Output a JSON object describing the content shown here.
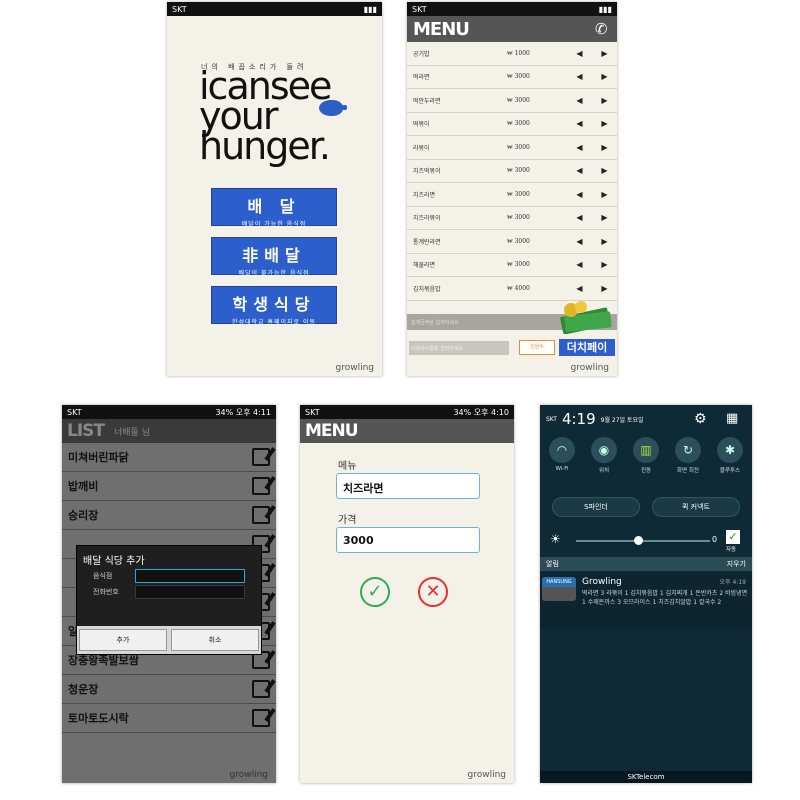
{
  "colors": {
    "accent_blue": "#2c5fcc",
    "check_green": "#33aa55",
    "cancel_red": "#e53030",
    "input_border": "#6ab4d9"
  },
  "screen1": {
    "carrier": "SKT",
    "tagline": "너의 배꼽소리가 들려",
    "logo_lines": [
      "icansee",
      "your",
      "hunger."
    ],
    "buttons": [
      {
        "main": "배 달",
        "sub": "배달이 가능한 음식점"
      },
      {
        "main": "非배달",
        "sub": "배달이 불가능한 음식점"
      },
      {
        "main": "학생식당",
        "sub": "한성대학교 홈페이지로 이동"
      }
    ],
    "brand": "growling"
  },
  "screen2": {
    "carrier": "SKT",
    "title": "MENU",
    "items": [
      {
        "name": "공기밥",
        "price": "₩ 1000"
      },
      {
        "name": "떡라면",
        "price": "₩ 3000"
      },
      {
        "name": "떡만두라면",
        "price": "₩ 3000"
      },
      {
        "name": "떡볶이",
        "price": "₩ 3000"
      },
      {
        "name": "라볶이",
        "price": "₩ 3000"
      },
      {
        "name": "치즈떡볶이",
        "price": "₩ 3000"
      },
      {
        "name": "치즈라면",
        "price": "₩ 3000"
      },
      {
        "name": "치즈라볶이",
        "price": "₩ 3000"
      },
      {
        "name": "통계란라면",
        "price": "₩ 3000"
      },
      {
        "name": "해물라면",
        "price": "₩ 3000"
      },
      {
        "name": "김치볶음밥",
        "price": "₩ 4000"
      }
    ],
    "footer_placeholder": "합계금액을 입력하세요",
    "input_placeholder": "사용자이름을 입력하세요",
    "count_label": "인원수",
    "pay_button": "더치페이",
    "brand": "growling"
  },
  "screen3": {
    "carrier": "SKT",
    "status_right": "34% 오후 4:11",
    "title": "LIST",
    "subtitle": "너배들 님",
    "items": [
      "미쳐버린파닭",
      "밥깨비",
      "승리장",
      "",
      "",
      "",
      "일품돈까스",
      "장충왕족발보쌈",
      "청운장",
      "토마토도시락"
    ],
    "dialog": {
      "title": "배달 식당 추가",
      "field1": "음식점",
      "field2": "전화번호",
      "add": "추가",
      "cancel": "취소"
    },
    "brand": "growling"
  },
  "screen4": {
    "carrier": "SKT",
    "status_right": "34% 오후 4:10",
    "title": "MENU",
    "menu_label": "메뉴",
    "menu_value": "치즈라면",
    "price_label": "가격",
    "price_value": "3000",
    "brand": "growling"
  },
  "screen5": {
    "carrier_left": "SKT",
    "time": "4:19",
    "date": "9월 27일 토요일",
    "quick": [
      {
        "label": "Wi-Fi",
        "icon": "wifi-icon",
        "glyph": "◠"
      },
      {
        "label": "위치",
        "icon": "location-icon",
        "glyph": "◉"
      },
      {
        "label": "진동",
        "icon": "vibrate-icon",
        "glyph": "▥"
      },
      {
        "label": "화면 회전",
        "icon": "rotate-icon",
        "glyph": "↻"
      },
      {
        "label": "블루투스",
        "icon": "bluetooth-icon",
        "glyph": "✱"
      }
    ],
    "finder": "S파인더",
    "quick_connect": "퀵 커넥트",
    "brightness_value": "0",
    "auto": "자동",
    "notice_label": "알림",
    "clear": "지우기",
    "noti_logo": "HANSUNG",
    "noti_title": "Growling",
    "noti_time": "오후 4:19",
    "noti_body": "떡라면 3  라볶이 1  김치볶음밥 1  김치찌개 1  돈반카츠 2  비빔냉면 1  수제돈까스 3  오므라이스 1  치즈김치알밥 1  칼국수 2",
    "carrier_footer": "SKTelecom"
  }
}
